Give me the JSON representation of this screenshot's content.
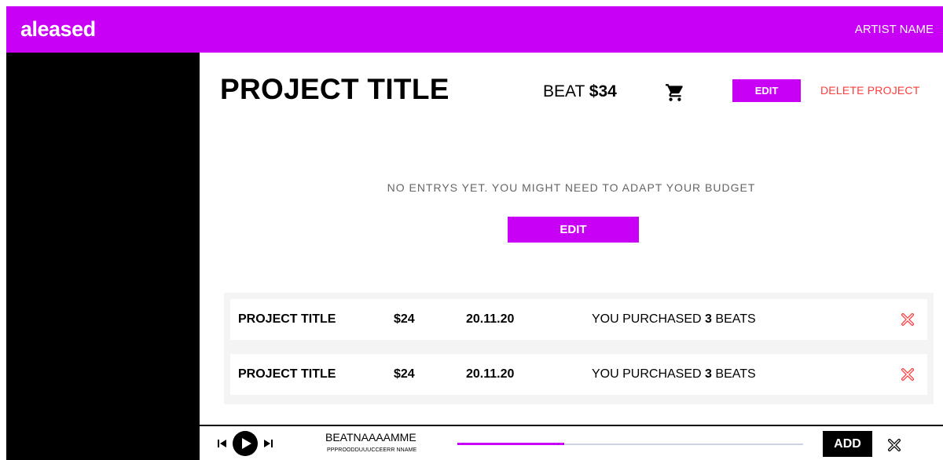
{
  "app": {
    "brand": "aleased",
    "artist_name": "ARTIST NAME"
  },
  "project": {
    "title": "PROJECT TITLE",
    "beat_label": "BEAT",
    "beat_price": "$34",
    "edit_label": "EDIT",
    "delete_label": "DELETE PROJECT"
  },
  "empty_state": {
    "message": "NO ENTRYS YET. YOU MIGHT NEED TO ADAPT YOUR BUDGET",
    "edit_label": "EDIT"
  },
  "entries": [
    {
      "title": "PROJECT TITLE",
      "amount": "$24",
      "date": "20.11.20",
      "desc_prefix": "YOU PURCHASED",
      "count": "3",
      "desc_suffix": "BEATS"
    },
    {
      "title": "PROJECT TITLE",
      "amount": "$24",
      "date": "20.11.20",
      "desc_prefix": "YOU PURCHASED",
      "count": "3",
      "desc_suffix": "BEATS"
    }
  ],
  "player": {
    "track_name": "BEATNAAAAMME",
    "producer": "PPPROODDUUUCCEERR NNAME",
    "progress": 0.31,
    "add_label": "ADD"
  },
  "colors": {
    "accent": "#c800f5",
    "danger": "#ff3b3b",
    "sidebar": "#000000"
  },
  "icons": {
    "cart": "cart-icon",
    "remove": "close-icon",
    "prev": "skip-previous-icon",
    "play": "play-icon",
    "next": "skip-next-icon"
  }
}
